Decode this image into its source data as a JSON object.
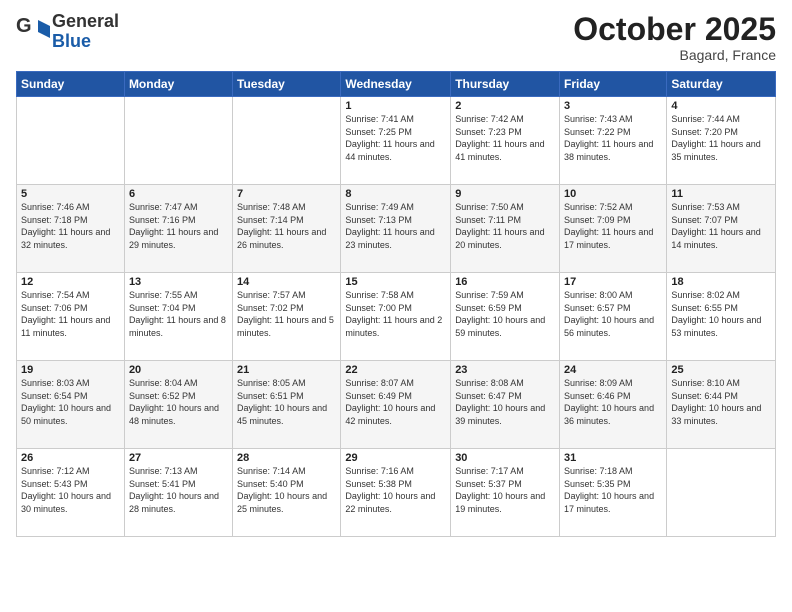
{
  "logo": {
    "general": "General",
    "blue": "Blue"
  },
  "header": {
    "month": "October 2025",
    "location": "Bagard, France"
  },
  "days_of_week": [
    "Sunday",
    "Monday",
    "Tuesday",
    "Wednesday",
    "Thursday",
    "Friday",
    "Saturday"
  ],
  "weeks": [
    [
      {
        "day": "",
        "info": ""
      },
      {
        "day": "",
        "info": ""
      },
      {
        "day": "",
        "info": ""
      },
      {
        "day": "1",
        "info": "Sunrise: 7:41 AM\nSunset: 7:25 PM\nDaylight: 11 hours\nand 44 minutes."
      },
      {
        "day": "2",
        "info": "Sunrise: 7:42 AM\nSunset: 7:23 PM\nDaylight: 11 hours\nand 41 minutes."
      },
      {
        "day": "3",
        "info": "Sunrise: 7:43 AM\nSunset: 7:22 PM\nDaylight: 11 hours\nand 38 minutes."
      },
      {
        "day": "4",
        "info": "Sunrise: 7:44 AM\nSunset: 7:20 PM\nDaylight: 11 hours\nand 35 minutes."
      }
    ],
    [
      {
        "day": "5",
        "info": "Sunrise: 7:46 AM\nSunset: 7:18 PM\nDaylight: 11 hours\nand 32 minutes."
      },
      {
        "day": "6",
        "info": "Sunrise: 7:47 AM\nSunset: 7:16 PM\nDaylight: 11 hours\nand 29 minutes."
      },
      {
        "day": "7",
        "info": "Sunrise: 7:48 AM\nSunset: 7:14 PM\nDaylight: 11 hours\nand 26 minutes."
      },
      {
        "day": "8",
        "info": "Sunrise: 7:49 AM\nSunset: 7:13 PM\nDaylight: 11 hours\nand 23 minutes."
      },
      {
        "day": "9",
        "info": "Sunrise: 7:50 AM\nSunset: 7:11 PM\nDaylight: 11 hours\nand 20 minutes."
      },
      {
        "day": "10",
        "info": "Sunrise: 7:52 AM\nSunset: 7:09 PM\nDaylight: 11 hours\nand 17 minutes."
      },
      {
        "day": "11",
        "info": "Sunrise: 7:53 AM\nSunset: 7:07 PM\nDaylight: 11 hours\nand 14 minutes."
      }
    ],
    [
      {
        "day": "12",
        "info": "Sunrise: 7:54 AM\nSunset: 7:06 PM\nDaylight: 11 hours\nand 11 minutes."
      },
      {
        "day": "13",
        "info": "Sunrise: 7:55 AM\nSunset: 7:04 PM\nDaylight: 11 hours\nand 8 minutes."
      },
      {
        "day": "14",
        "info": "Sunrise: 7:57 AM\nSunset: 7:02 PM\nDaylight: 11 hours\nand 5 minutes."
      },
      {
        "day": "15",
        "info": "Sunrise: 7:58 AM\nSunset: 7:00 PM\nDaylight: 11 hours\nand 2 minutes."
      },
      {
        "day": "16",
        "info": "Sunrise: 7:59 AM\nSunset: 6:59 PM\nDaylight: 10 hours\nand 59 minutes."
      },
      {
        "day": "17",
        "info": "Sunrise: 8:00 AM\nSunset: 6:57 PM\nDaylight: 10 hours\nand 56 minutes."
      },
      {
        "day": "18",
        "info": "Sunrise: 8:02 AM\nSunset: 6:55 PM\nDaylight: 10 hours\nand 53 minutes."
      }
    ],
    [
      {
        "day": "19",
        "info": "Sunrise: 8:03 AM\nSunset: 6:54 PM\nDaylight: 10 hours\nand 50 minutes."
      },
      {
        "day": "20",
        "info": "Sunrise: 8:04 AM\nSunset: 6:52 PM\nDaylight: 10 hours\nand 48 minutes."
      },
      {
        "day": "21",
        "info": "Sunrise: 8:05 AM\nSunset: 6:51 PM\nDaylight: 10 hours\nand 45 minutes."
      },
      {
        "day": "22",
        "info": "Sunrise: 8:07 AM\nSunset: 6:49 PM\nDaylight: 10 hours\nand 42 minutes."
      },
      {
        "day": "23",
        "info": "Sunrise: 8:08 AM\nSunset: 6:47 PM\nDaylight: 10 hours\nand 39 minutes."
      },
      {
        "day": "24",
        "info": "Sunrise: 8:09 AM\nSunset: 6:46 PM\nDaylight: 10 hours\nand 36 minutes."
      },
      {
        "day": "25",
        "info": "Sunrise: 8:10 AM\nSunset: 6:44 PM\nDaylight: 10 hours\nand 33 minutes."
      }
    ],
    [
      {
        "day": "26",
        "info": "Sunrise: 7:12 AM\nSunset: 5:43 PM\nDaylight: 10 hours\nand 30 minutes."
      },
      {
        "day": "27",
        "info": "Sunrise: 7:13 AM\nSunset: 5:41 PM\nDaylight: 10 hours\nand 28 minutes."
      },
      {
        "day": "28",
        "info": "Sunrise: 7:14 AM\nSunset: 5:40 PM\nDaylight: 10 hours\nand 25 minutes."
      },
      {
        "day": "29",
        "info": "Sunrise: 7:16 AM\nSunset: 5:38 PM\nDaylight: 10 hours\nand 22 minutes."
      },
      {
        "day": "30",
        "info": "Sunrise: 7:17 AM\nSunset: 5:37 PM\nDaylight: 10 hours\nand 19 minutes."
      },
      {
        "day": "31",
        "info": "Sunrise: 7:18 AM\nSunset: 5:35 PM\nDaylight: 10 hours\nand 17 minutes."
      },
      {
        "day": "",
        "info": ""
      }
    ]
  ]
}
